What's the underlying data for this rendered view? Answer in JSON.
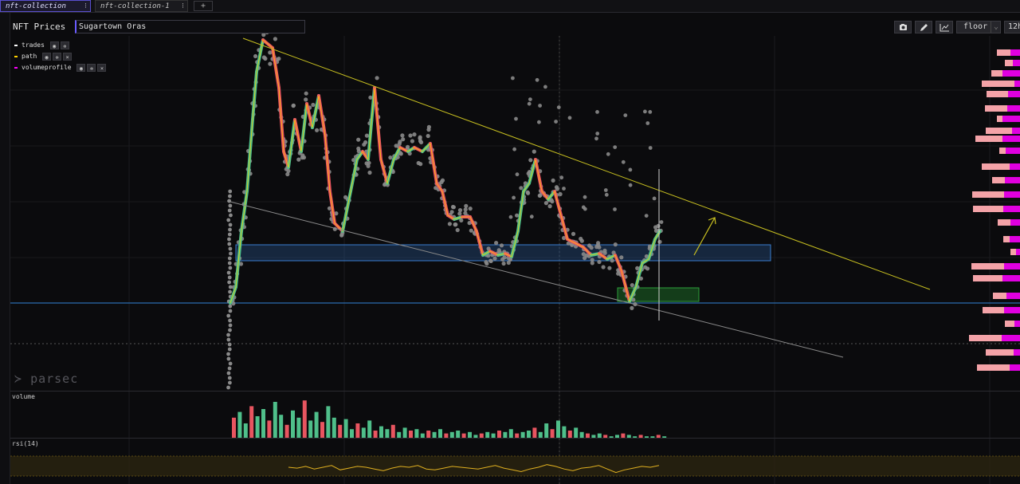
{
  "tabs": [
    {
      "label": "nft-collection",
      "menu": "⁝"
    },
    {
      "label": "nft-collection-1",
      "menu": "⁝"
    }
  ],
  "add_tab": "+",
  "panel": {
    "title": "NFT Prices",
    "collection_name": "Sugartown Oras",
    "metric_select": "floor",
    "metric_caret": "⌄",
    "timeframe": "12h",
    "tool_icons": [
      "camera-icon",
      "pencil-icon",
      "line-chart-icon"
    ]
  },
  "legend": [
    {
      "label": "trades",
      "color": "#ffffff",
      "icons": [
        "eye-icon",
        "gear-icon"
      ]
    },
    {
      "label": "path",
      "color": "#ffd200",
      "icons": [
        "eye-icon",
        "gear-icon",
        "close-icon"
      ]
    },
    {
      "label": "volumeprofile",
      "color": "#ff00ff",
      "icons": [
        "eye-icon",
        "gear-icon",
        "close-icon"
      ]
    }
  ],
  "close_glyph": "×",
  "watermark": "parsec",
  "volume_panel_label": "volume",
  "rsi_panel_label": "rsi(14)",
  "colors": {
    "up": "#4fbf8a",
    "down": "#e85560",
    "trades": "#8a8a8a",
    "trend_line": "#c8c020",
    "support_line": "#2a6bb0",
    "zone_blue": "#2a5d9a",
    "zone_green": "#1f7a2a",
    "profile_pink": "#f4a3a8",
    "profile_magenta": "#e000e0"
  },
  "chart_data": {
    "type": "line",
    "volume": [
      14,
      18,
      10,
      22,
      15,
      20,
      12,
      25,
      16,
      9,
      19,
      14,
      26,
      12,
      18,
      11,
      22,
      14,
      9,
      13,
      6,
      10,
      7,
      12,
      5,
      8,
      6,
      9,
      4,
      7,
      5,
      6,
      3,
      5,
      4,
      6,
      3,
      4,
      5,
      3,
      4,
      2,
      3,
      4,
      3,
      5,
      4,
      6,
      3,
      4,
      5,
      7,
      4,
      10,
      6,
      12,
      8,
      5,
      7,
      4,
      3,
      2,
      3,
      2,
      1,
      2,
      3,
      2,
      1,
      2,
      1,
      1,
      2,
      1
    ],
    "rsi": [
      50,
      49,
      51,
      48,
      50,
      52,
      47,
      49,
      51,
      50,
      48,
      46,
      49,
      51,
      50,
      52,
      48,
      47,
      49,
      51,
      50,
      49,
      48,
      50,
      52,
      49,
      47,
      45,
      48,
      50,
      53,
      51,
      48,
      46,
      49,
      50,
      52,
      48,
      44,
      47,
      49,
      51,
      50,
      52
    ]
  }
}
